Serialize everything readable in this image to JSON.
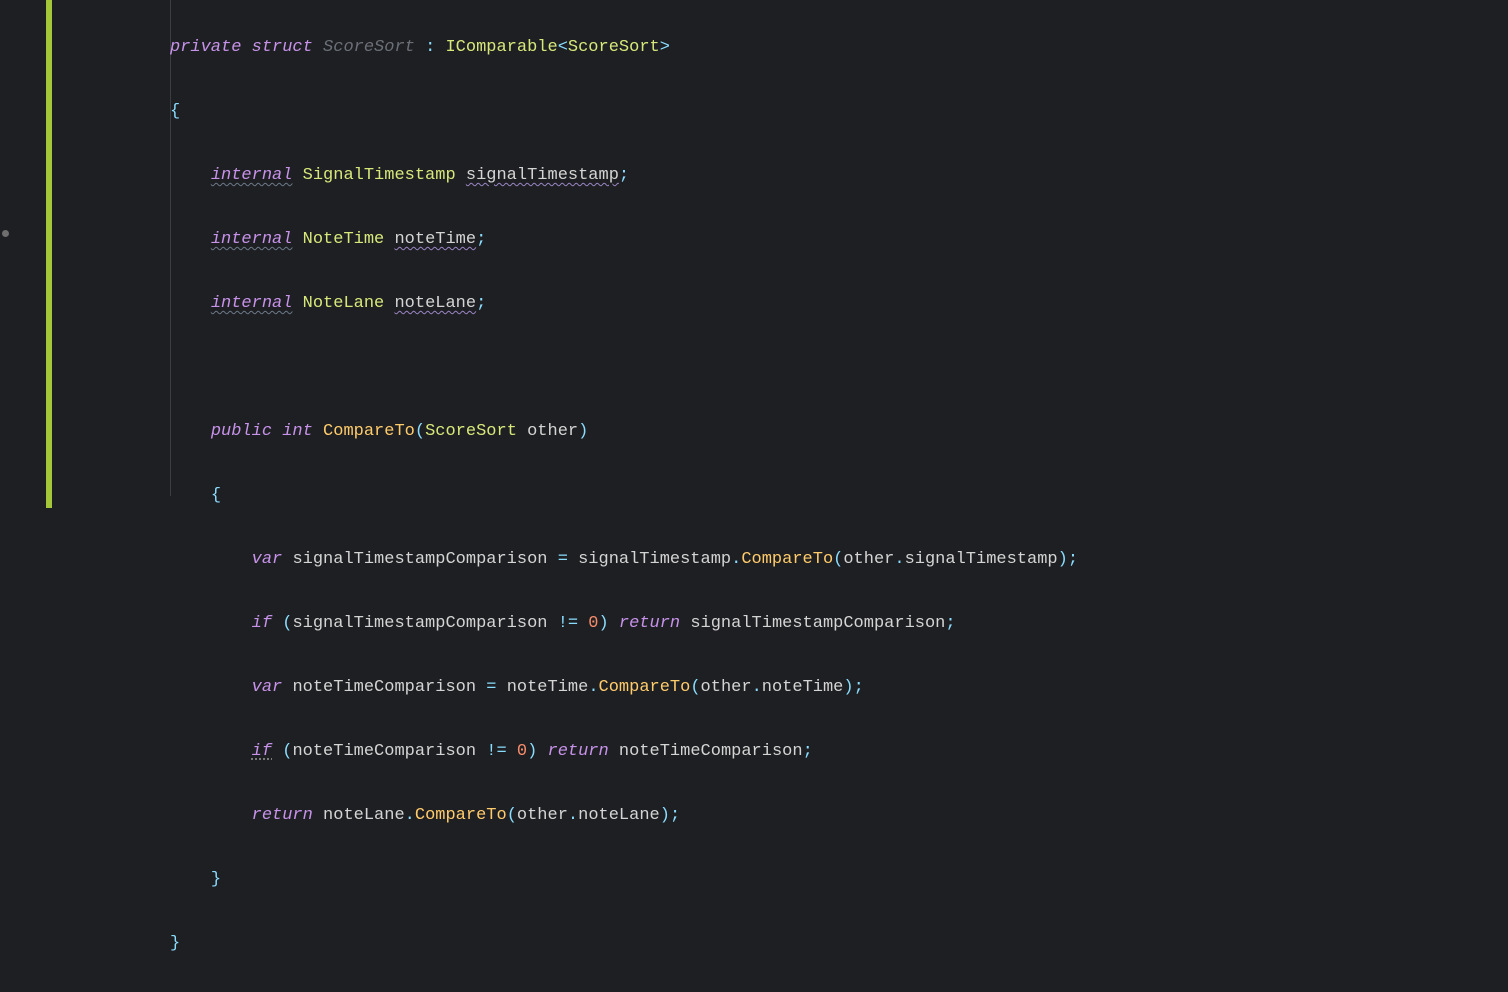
{
  "kw": {
    "private": "private",
    "struct": "struct",
    "internal": "internal",
    "public": "public",
    "int": "int",
    "var": "var",
    "if": "if",
    "return": "return"
  },
  "types": {
    "ScoreSort": "ScoreSort",
    "IComparable": "IComparable",
    "SignalTimestamp": "SignalTimestamp",
    "NoteTime": "NoteTime",
    "NoteLane": "NoteLane"
  },
  "fields": {
    "signalTimestamp": "signalTimestamp",
    "noteTime": "noteTime",
    "noteLane": "noteLane"
  },
  "method": {
    "CompareTo": "CompareTo",
    "param": "other"
  },
  "locals": {
    "signalTimestampComparison": "signalTimestampComparison",
    "noteTimeComparison": "noteTimeComparison"
  },
  "literals": {
    "zero": "0"
  },
  "punct": {
    "lbrace": "{",
    "rbrace": "}",
    "lparen": "(",
    "rparen": ")",
    "lt": "<",
    "gt": ">",
    "colon": ":",
    "semi": ";",
    "dot": ".",
    "eq": "=",
    "neq": "!="
  }
}
